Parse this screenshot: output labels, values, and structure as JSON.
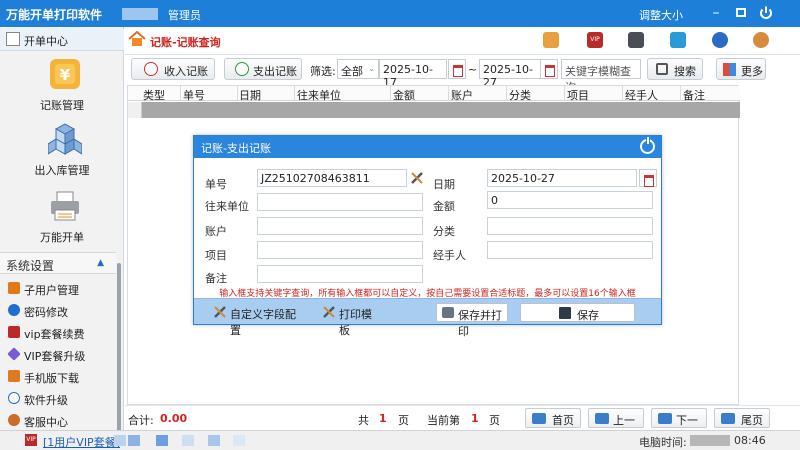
{
  "app": {
    "title": "万能开单打印软件",
    "user": "管理员",
    "resize_label": "调整大小",
    "window_buttons": [
      "minimize-icon",
      "maximize-icon",
      "power-icon"
    ]
  },
  "sidebar": {
    "header": "开单中心",
    "big_items": [
      {
        "label": "记账管理",
        "icon": "yen-icon"
      },
      {
        "label": "出入库管理",
        "icon": "boxes-icon"
      },
      {
        "label": "万能开单",
        "icon": "printer-icon"
      }
    ],
    "system_header": "系统设置",
    "items": [
      {
        "label": "子用户管理",
        "icon": "user-manage-icon",
        "color": "#e07a1f"
      },
      {
        "label": "密码修改",
        "icon": "question-icon",
        "color": "#1e6fd0"
      },
      {
        "label": "vip套餐续费",
        "icon": "vip-icon",
        "color": "#b72b2b"
      },
      {
        "label": "VIP套餐升级",
        "icon": "diamond-icon",
        "color": "#7a5bd3"
      },
      {
        "label": "手机版下载",
        "icon": "phone-icon",
        "color": "#e07a1f"
      },
      {
        "label": "软件升级",
        "icon": "upgrade-icon",
        "color": "#2a6bc8"
      },
      {
        "label": "客服中心",
        "icon": "service-icon",
        "color": "#c76e2c"
      }
    ]
  },
  "main": {
    "title": "记账-记账查询",
    "top_icons": [
      "home-icon",
      "vip-icon",
      "calculator-icon",
      "network-icon",
      "user-key-icon",
      "service-icon"
    ]
  },
  "toolbar": {
    "income_label": "收入记账",
    "expense_label": "支出记账",
    "filter_label": "筛选:",
    "filter_value": "全部",
    "date_from": "2025-10-17",
    "date_sep": "~",
    "date_to": "2025-10-27",
    "keyword_placeholder": "关键字模糊查询",
    "search_label": "搜索",
    "more_label": "更多"
  },
  "table": {
    "columns": [
      "类型",
      "单号",
      "日期",
      "往来单位",
      "金额",
      "账户",
      "分类",
      "项目",
      "经手人",
      "备注"
    ]
  },
  "footer": {
    "total_label": "合计:",
    "total_value": "0.00",
    "total_pages_prefix": "共",
    "total_pages": "1",
    "pages_suffix": "页",
    "current_prefix": "当前第",
    "current_page": "1",
    "current_suffix": "页",
    "first": "首页",
    "prev": "上一页",
    "next": "下一页",
    "last": "尾页"
  },
  "status": {
    "vip_link": "[1用户VIP套餐]",
    "time_label": "电脑时间:",
    "time": "08:46"
  },
  "dialog": {
    "title": "记账-支出记账",
    "fields": {
      "order_no_label": "单号",
      "order_no": "JZ25102708463811",
      "date_label": "日期",
      "date": "2025-10-27",
      "partner_label": "往来单位",
      "partner": "",
      "amount_label": "金额",
      "amount": "0",
      "account_label": "账户",
      "account": "",
      "category_label": "分类",
      "category": "",
      "project_label": "项目",
      "project": "",
      "handler_label": "经手人",
      "handler": "",
      "remark_label": "备注",
      "remark": ""
    },
    "note": "输入框支持关键字查询，所有输入框都可以自定义，按自己需要设置合适标题，最多可以设置16个输入框",
    "custom_fields_label": "自定义字段配置",
    "print_template_label": "打印模板",
    "save_print_label": "保存并打印",
    "save_label": "保存"
  }
}
